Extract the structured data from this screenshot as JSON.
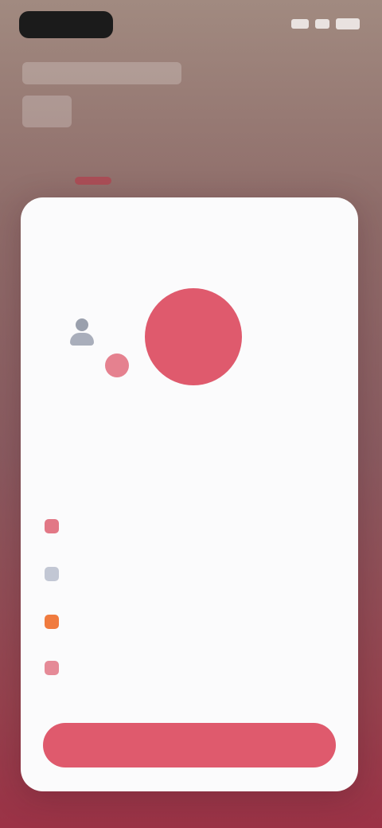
{
  "status_bar": {
    "time": "",
    "icons": [
      "signal-icon",
      "wifi-icon",
      "battery-icon"
    ]
  },
  "card": {
    "title": "",
    "subtitle": "",
    "left_label": "",
    "circle_label": "",
    "options_heading": "",
    "options": [
      {
        "icon": "heart-icon",
        "label": ""
      },
      {
        "icon": "calendar-icon",
        "label": ""
      },
      {
        "icon": "flame-icon",
        "label": ""
      },
      {
        "icon": "trash-icon",
        "label": ""
      }
    ],
    "primary_button_label": ""
  },
  "colors": {
    "accent": "#df5a6d",
    "card_background": "#fbfbfc",
    "status_pill": "#1b1b1b"
  }
}
